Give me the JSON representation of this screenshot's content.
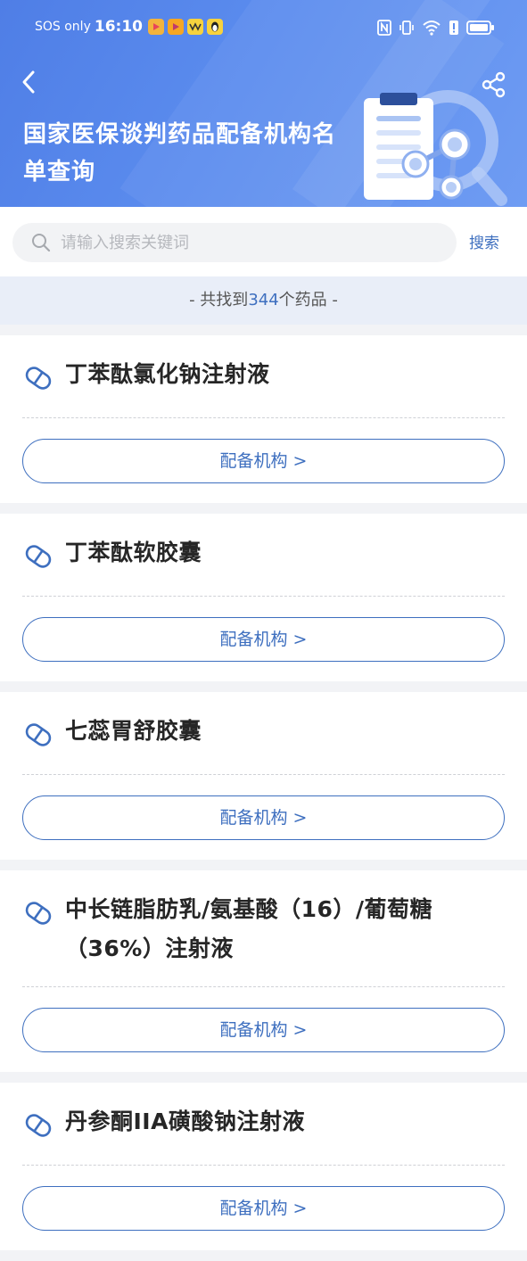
{
  "status_bar": {
    "carrier": "SOS only",
    "time": "16:10",
    "app_icons": [
      "video-app-icon",
      "video-app-icon-2",
      "yellow-app-icon",
      "qq-penguin-icon"
    ],
    "right_icons": [
      "nfc-icon",
      "vibrate-icon",
      "wifi-icon",
      "alert-icon",
      "battery-icon"
    ]
  },
  "header": {
    "title": "国家医保谈判药品配备机构名单查询",
    "back_icon": "back-chevron-icon",
    "share_icon": "share-icon",
    "illustration": "clipboard-search-illustration"
  },
  "search": {
    "placeholder": "请输入搜索关键词",
    "value": "",
    "button_label": "搜索"
  },
  "result": {
    "prefix": "- 共找到",
    "count": "344",
    "suffix": "个药品 -"
  },
  "drugs": [
    {
      "name": "丁苯酞氯化钠注射液",
      "button_label": "配备机构 >"
    },
    {
      "name": "丁苯酞软胶囊",
      "button_label": "配备机构 >"
    },
    {
      "name": "七蕊胃舒胶囊",
      "button_label": "配备机构 >"
    },
    {
      "name": "中长链脂肪乳/氨基酸（16）/葡萄糖（36%）注射液",
      "button_label": "配备机构 >"
    },
    {
      "name": "丹参酮IIA磺酸钠注射液",
      "button_label": "配备机构 >"
    }
  ],
  "colors": {
    "header_blue": "#5b8cee",
    "accent": "#3e6fbf",
    "result_bg": "#e9eef8",
    "page_bg": "#f2f3f6"
  }
}
